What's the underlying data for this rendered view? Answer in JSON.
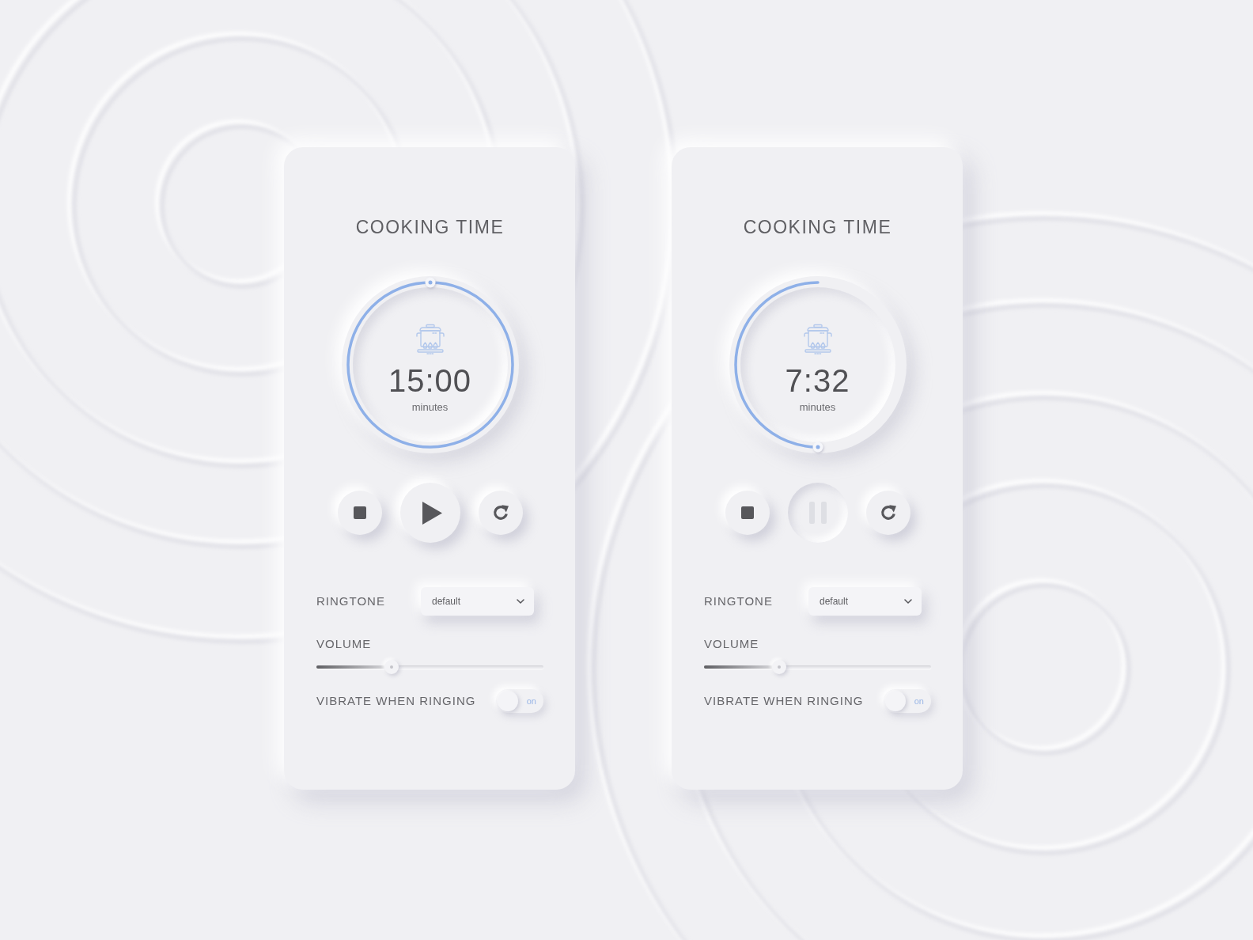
{
  "cards": [
    {
      "title": "COOKING TIME",
      "timer": {
        "time": "15:00",
        "unit": "minutes",
        "level": 1
      },
      "controls": [
        {
          "kind": "stop",
          "pressed": false
        },
        {
          "kind": "play",
          "pressed": false
        },
        {
          "kind": "reset",
          "pressed": false
        }
      ],
      "ringtone": {
        "label": "RINGTONE",
        "value": "default"
      },
      "volume": {
        "label": "VOLUME",
        "level": 0.33
      },
      "vibrate": {
        "label": "VIBRATE WHEN RINGING",
        "on": false,
        "switch_text": "on"
      }
    },
    {
      "title": "COOKING TIME",
      "timer": {
        "time": "7:32",
        "unit": "minutes",
        "level": 0.5
      },
      "controls": [
        {
          "kind": "stop",
          "pressed": false
        },
        {
          "kind": "pause",
          "pressed": true
        },
        {
          "kind": "reset",
          "pressed": false
        }
      ],
      "ringtone": {
        "label": "RINGTONE",
        "value": "default"
      },
      "volume": {
        "label": "VOLUME",
        "level": 0.33
      },
      "vibrate": {
        "label": "VIBRATE WHEN RINGING",
        "on": false,
        "switch_text": "on"
      }
    }
  ]
}
